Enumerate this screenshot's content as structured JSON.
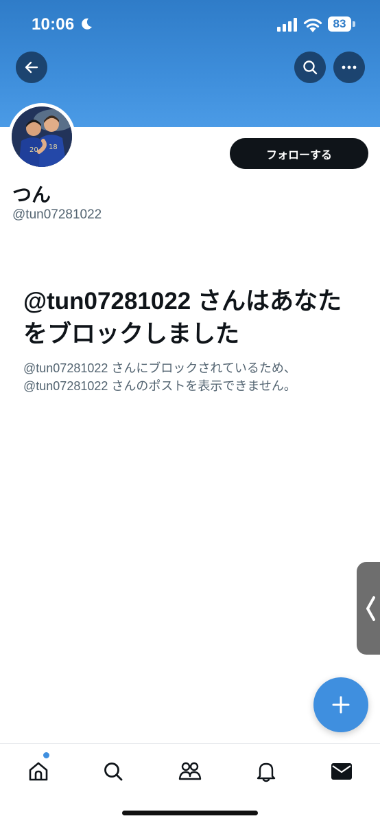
{
  "status_bar": {
    "time": "10:06",
    "battery": "83",
    "icons": [
      "moon-icon",
      "signal-icon",
      "wifi-icon",
      "battery-icon"
    ]
  },
  "header": {
    "banner_color": "#3e8edb",
    "buttons": [
      "back-arrow-icon",
      "search-icon",
      "more-icon"
    ]
  },
  "profile": {
    "follow_label": "フォローする",
    "display_name": "つん",
    "handle": "@tun07281022"
  },
  "blocked_notice": {
    "title": "@tun07281022 さんはあなたをブロックしました",
    "description_line1": "@tun07281022 さんにブロックされているため、",
    "description_line2": "@tun07281022 さんのポストを表示できません。"
  },
  "floating": {
    "compose_icon": "plus-icon",
    "side_handle_icon": "chevron-left-icon",
    "accent": "#3f8fdf"
  },
  "bottom_nav": {
    "items": [
      "home-icon",
      "search-icon",
      "communities-icon",
      "notifications-icon",
      "messages-icon"
    ],
    "home_has_badge": true
  }
}
